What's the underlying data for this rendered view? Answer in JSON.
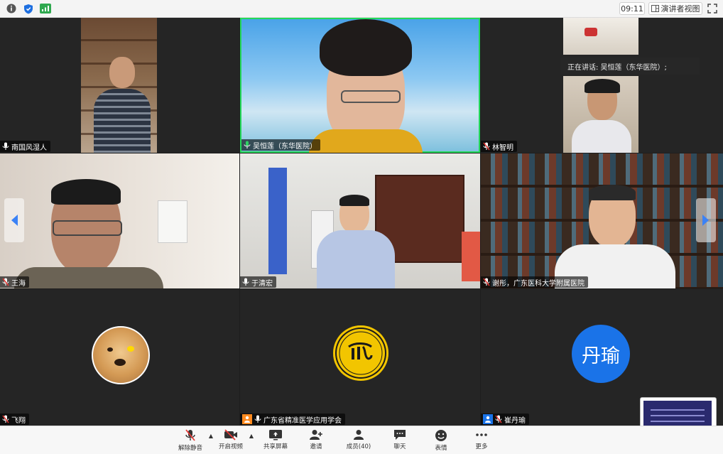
{
  "window": {
    "time": "09:11",
    "speaker_view_label": "演讲者视图"
  },
  "speaking_now": {
    "label": "正在讲话: 吴恒莲（东华医院）;"
  },
  "participants": [
    {
      "name": "南国风湿人",
      "muted": false
    },
    {
      "name": "吴恒莲（东华医院）",
      "muted": false,
      "active_speaker": true
    },
    {
      "name": "林智明",
      "muted": true
    },
    {
      "name": "王海",
      "muted": true
    },
    {
      "name": "于清宏",
      "muted": false
    },
    {
      "name": "谢彤，广东医科大学附属医院",
      "muted": true
    },
    {
      "name": "飞翔",
      "muted": true
    },
    {
      "name": "广东省精准医学应用学会",
      "muted": false
    },
    {
      "name": "崔丹瑜",
      "muted": true,
      "avatar_text": "丹瑜"
    }
  ],
  "toolbar": {
    "unmute": "解除静音",
    "start_video": "开启视频",
    "share_screen": "共享屏幕",
    "invite": "邀请",
    "participants": "成员(40)",
    "chat": "聊天",
    "reactions": "表情",
    "more": "更多"
  },
  "colors": {
    "active_border": "#23d959",
    "avatar_blue": "#1a73e8",
    "logo_gold": "#f2c500",
    "nav_arrow": "#3b82f6",
    "muted_red": "#e53935"
  }
}
